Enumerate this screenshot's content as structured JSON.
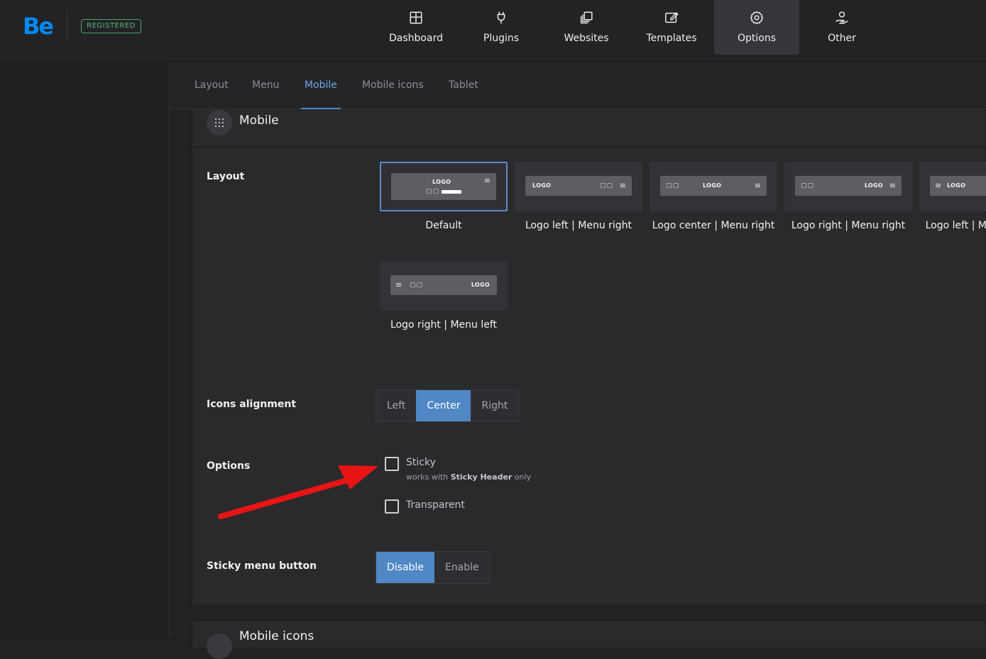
{
  "brand": {
    "logo": "Be",
    "badge": "REGISTERED"
  },
  "nav": [
    {
      "label": "Dashboard",
      "icon": "dashboard-icon",
      "active": false
    },
    {
      "label": "Plugins",
      "icon": "plug-icon",
      "active": false
    },
    {
      "label": "Websites",
      "icon": "websites-icon",
      "active": false
    },
    {
      "label": "Templates",
      "icon": "templates-icon",
      "active": false
    },
    {
      "label": "Options",
      "icon": "gear-icon",
      "active": true
    },
    {
      "label": "Other",
      "icon": "user-hand-icon",
      "active": false
    }
  ],
  "subtabs": [
    {
      "label": "Layout",
      "active": false
    },
    {
      "label": "Menu",
      "active": false
    },
    {
      "label": "Mobile",
      "active": true
    },
    {
      "label": "Mobile icons",
      "active": false
    },
    {
      "label": "Tablet",
      "active": false
    }
  ],
  "panel": {
    "title": "Mobile",
    "layout": {
      "label": "Layout",
      "options": [
        {
          "caption": "Default",
          "selected": true,
          "logo_text": "LOGO"
        },
        {
          "caption": "Logo left | Menu right",
          "selected": false,
          "logo_text": "LOGO"
        },
        {
          "caption": "Logo center | Menu right",
          "selected": false,
          "logo_text": "LOGO"
        },
        {
          "caption": "Logo right | Menu right",
          "selected": false,
          "logo_text": "LOGO"
        },
        {
          "caption": "Logo left | M",
          "selected": false,
          "logo_text": "LOGO"
        },
        {
          "caption": "Logo right | Menu left",
          "selected": false,
          "logo_text": "LOGO"
        }
      ]
    },
    "icons_alignment": {
      "label": "Icons alignment",
      "options": [
        "Left",
        "Center",
        "Right"
      ],
      "selected": "Center"
    },
    "options": {
      "label": "Options",
      "sticky": {
        "label": "Sticky",
        "checked": false,
        "hint_prefix": "works with",
        "hint_bold": "Sticky Header",
        "hint_suffix": "only"
      },
      "transparent": {
        "label": "Transparent",
        "checked": false
      }
    },
    "sticky_menu_button": {
      "label": "Sticky menu button",
      "options": [
        "Disable",
        "Enable"
      ],
      "selected": "Disable"
    }
  },
  "next_panel": {
    "title": "Mobile icons"
  },
  "colors": {
    "accent": "#4f88c4",
    "brand": "#0089f7",
    "badge": "#58b878",
    "annotation_arrow": "#e81414"
  }
}
